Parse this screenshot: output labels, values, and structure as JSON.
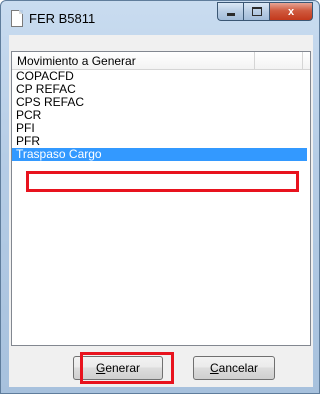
{
  "window": {
    "title": "FER B5811",
    "close_glyph": "x",
    "icons": {
      "app": "document-icon",
      "minimize": "minimize-icon",
      "maximize": "maximize-icon",
      "close": "close-icon"
    }
  },
  "list": {
    "columns": [
      "Movimiento a Generar",
      ""
    ],
    "items": [
      {
        "label": "COPACFD",
        "selected": false
      },
      {
        "label": "CP REFAC",
        "selected": false
      },
      {
        "label": "CPS REFAC",
        "selected": false
      },
      {
        "label": "PCR",
        "selected": false
      },
      {
        "label": "PFI",
        "selected": false
      },
      {
        "label": "PFR",
        "selected": false
      },
      {
        "label": "Traspaso Cargo",
        "selected": true
      }
    ]
  },
  "buttons": {
    "generar": {
      "mnemonic": "G",
      "rest": "enerar"
    },
    "cancelar": {
      "mnemonic": "C",
      "rest": "ancelar"
    }
  },
  "colors": {
    "selection": "#3399ff",
    "highlight": "#e8131e",
    "close_button": "#c3391c"
  }
}
